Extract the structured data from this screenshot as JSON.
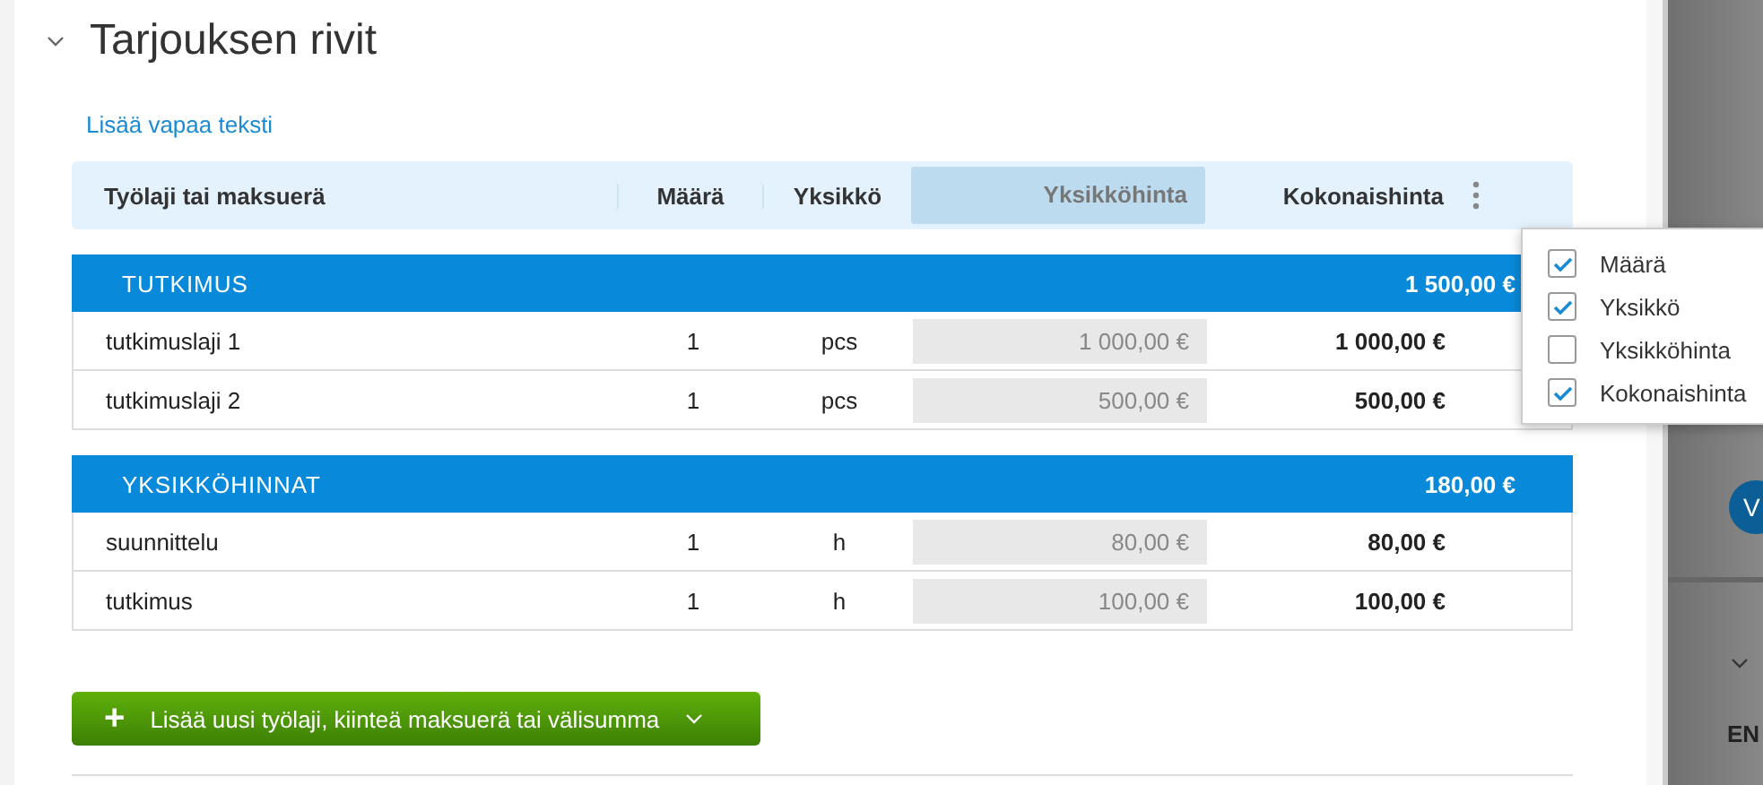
{
  "section": {
    "title": "Tarjouksen rivit",
    "expanded": true
  },
  "add_text_link": "Lisää vapaa teksti",
  "table": {
    "columns": [
      {
        "label": "Työlaji tai maksuerä",
        "kind": "name",
        "visible": true
      },
      {
        "label": "Määrä",
        "kind": "quantity",
        "visible": true
      },
      {
        "label": "Yksikkö",
        "kind": "unit",
        "visible": true
      },
      {
        "label": "Yksikköhinta",
        "kind": "unit_price",
        "visible": false
      },
      {
        "label": "Kokonaishinta",
        "kind": "total",
        "visible": true
      }
    ],
    "groups": [
      {
        "title": "TUTKIMUS",
        "total": "1 500,00 €",
        "rows": [
          {
            "name": "tutkimuslaji 1",
            "quantity": "1",
            "unit": "pcs",
            "unit_price": "1 000,00 €",
            "total": "1 000,00 €"
          },
          {
            "name": "tutkimuslaji 2",
            "quantity": "1",
            "unit": "pcs",
            "unit_price": "500,00 €",
            "total": "500,00 €"
          }
        ]
      },
      {
        "title": "YKSIKKÖHINNAT",
        "total": "180,00 €",
        "rows": [
          {
            "name": "suunnittelu",
            "quantity": "1",
            "unit": "h",
            "unit_price": "80,00 €",
            "total": "80,00 €"
          },
          {
            "name": "tutkimus",
            "quantity": "1",
            "unit": "h",
            "unit_price": "100,00 €",
            "total": "100,00 €"
          }
        ]
      }
    ]
  },
  "column_menu": {
    "items": [
      {
        "label": "Määrä",
        "checked": true
      },
      {
        "label": "Yksikkö",
        "checked": true
      },
      {
        "label": "Yksikköhinta",
        "checked": false
      },
      {
        "label": "Kokonaishinta",
        "checked": true
      }
    ]
  },
  "add_button": {
    "label": "Lisää uusi työlaji, kiinteä maksuerä tai välisumma",
    "icon": "+"
  },
  "side": {
    "avatar": "V",
    "text": "EN"
  }
}
